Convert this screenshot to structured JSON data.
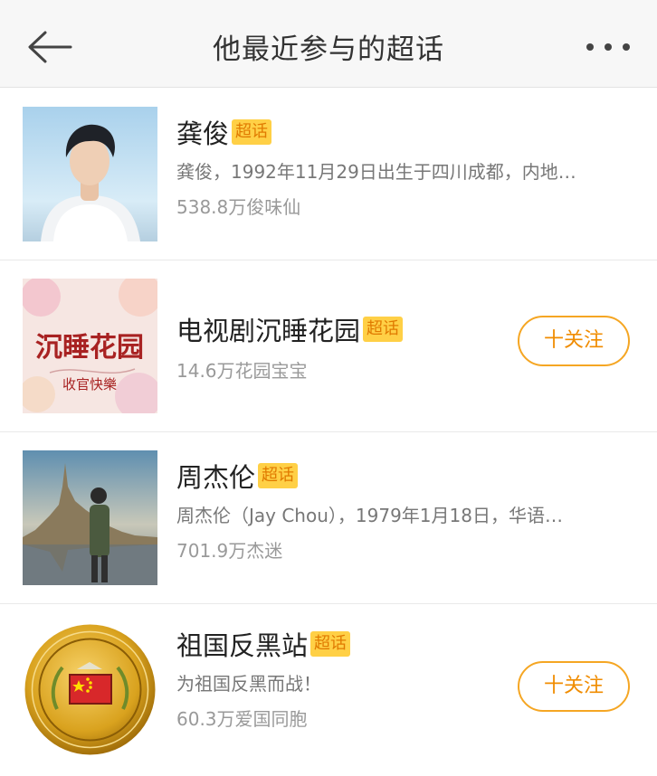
{
  "header": {
    "title": "他最近参与的超话",
    "back_icon": "back-arrow-icon",
    "more_icon": "more-dots-icon"
  },
  "items": [
    {
      "name": "龚俊",
      "badge": "超话",
      "desc": "龚俊，1992年11月29日出生于四川成都，内地…",
      "fans": "538.8万俊味仙",
      "follow": ""
    },
    {
      "name": "电视剧沉睡花园",
      "badge": "超话",
      "desc": "",
      "fans": "14.6万花园宝宝",
      "follow": "十关注",
      "poster_title": "沉睡花园",
      "poster_subtitle": "收官快樂"
    },
    {
      "name": "周杰伦",
      "badge": "超话",
      "desc": "周杰伦（Jay Chou），1979年1月18日，华语…",
      "fans": "701.9万杰迷",
      "follow": ""
    },
    {
      "name": "祖国反黑站",
      "badge": "超话",
      "desc": "为祖国反黑而战！",
      "fans": "60.3万爱国同胞",
      "follow": "十关注"
    }
  ],
  "colors": {
    "badge_bg": "#ffd046",
    "badge_text": "#e07a00",
    "follow_border": "#f5a623",
    "follow_text": "#f08c00"
  }
}
